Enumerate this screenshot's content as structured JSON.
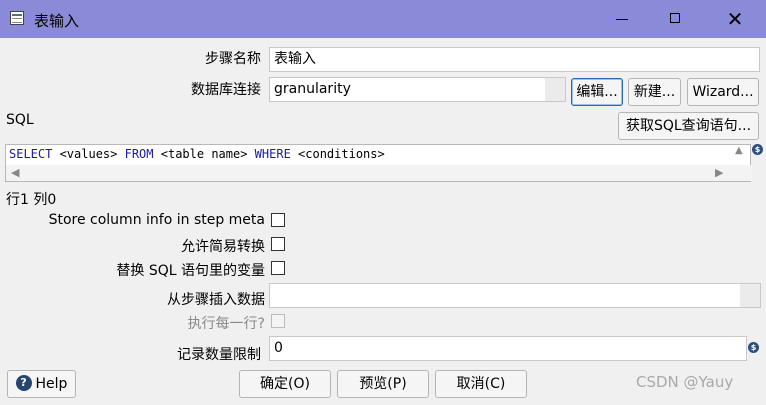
{
  "window": {
    "title": "表输入"
  },
  "form": {
    "step_name_label": "步骤名称",
    "step_name_value": "表输入",
    "connection_label": "数据库连接",
    "connection_value": "granularity",
    "edit_button": "编辑...",
    "new_button": "新建...",
    "wizard_button": "Wizard...",
    "sql_label": "SQL",
    "get_sql_button": "获取SQL查询语句...",
    "sql": {
      "kw1": "SELECT",
      "t1": " <values> ",
      "kw2": "FROM",
      "t2": " <table name> ",
      "kw3": "WHERE",
      "t3": " <conditions>"
    },
    "cursor_position": "行1 列0",
    "store_column_info_label": "Store column info in step meta",
    "lazy_conversion_label": "允许简易转换",
    "replace_variables_label": "替换 SQL 语句里的变量",
    "insert_from_step_label": "从步骤插入数据",
    "insert_from_step_value": "",
    "execute_each_row_label": "执行每一行?",
    "limit_label": "记录数量限制",
    "limit_value": "0"
  },
  "buttons": {
    "help": "Help",
    "ok": "确定(O)",
    "preview": "预览(P)",
    "cancel": "取消(C)"
  },
  "watermark": "CSDN @Yauy",
  "colors": {
    "titlebar": "#8a8ad8",
    "sql_keyword": "#1a1aa6",
    "focus_border": "#2a68b0"
  }
}
